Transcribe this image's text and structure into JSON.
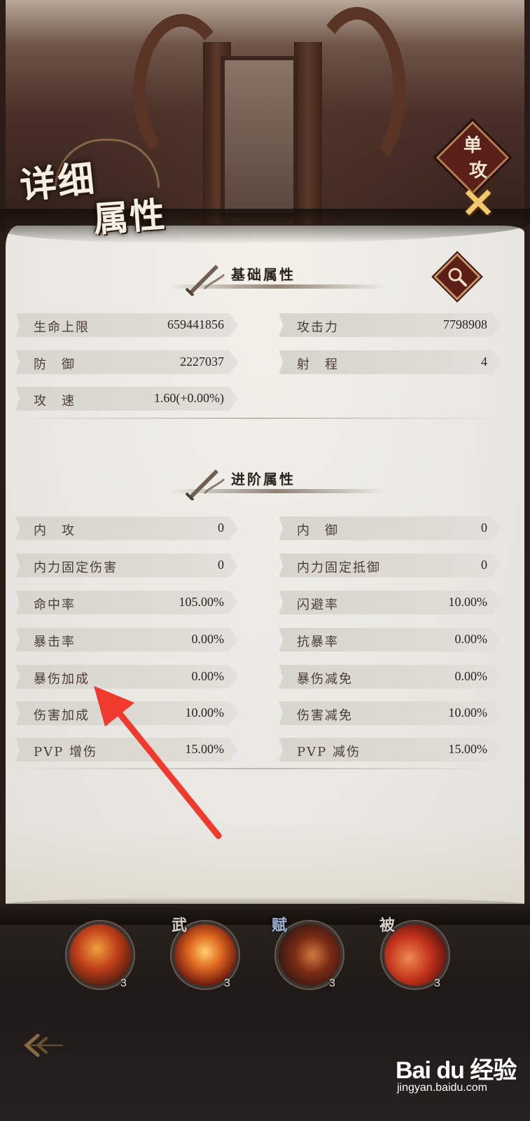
{
  "header": {
    "title_line1": "详细",
    "title_line2": "属性",
    "mode_badge": [
      "单",
      "攻"
    ]
  },
  "basic": {
    "heading": "基础属性",
    "stats": [
      {
        "name": "生命上限",
        "value": "659441856"
      },
      {
        "name": "攻击力",
        "value": "7798908"
      },
      {
        "name": "防　御",
        "value": "2227037"
      },
      {
        "name": "射　程",
        "value": "4"
      },
      {
        "name": "攻　速",
        "value": "1.60(+0.00%)"
      }
    ]
  },
  "advanced": {
    "heading": "进阶属性",
    "stats": [
      {
        "name": "内　攻",
        "value": "0"
      },
      {
        "name": "内　御",
        "value": "0"
      },
      {
        "name": "内力固定伤害",
        "value": "0"
      },
      {
        "name": "内力固定抵御",
        "value": "0"
      },
      {
        "name": "命中率",
        "value": "105.00%"
      },
      {
        "name": "闪避率",
        "value": "10.00%"
      },
      {
        "name": "暴击率",
        "value": "0.00%"
      },
      {
        "name": "抗暴率",
        "value": "0.00%"
      },
      {
        "name": "暴伤加成",
        "value": "0.00%"
      },
      {
        "name": "暴伤减免",
        "value": "0.00%"
      },
      {
        "name": "伤害加成",
        "value": "10.00%"
      },
      {
        "name": "伤害减免",
        "value": "10.00%"
      },
      {
        "name": "PVP 增伤",
        "value": "15.00%"
      },
      {
        "name": "PVP 减伤",
        "value": "15.00%"
      }
    ]
  },
  "skills": [
    {
      "badge": "",
      "level": "3"
    },
    {
      "badge": "武",
      "level": "3"
    },
    {
      "badge": "赋",
      "level": "3"
    },
    {
      "badge": "被",
      "level": "3"
    }
  ],
  "watermark": {
    "main": "Bai du 经验",
    "sub": "jingyan.baidu.com"
  },
  "colors": {
    "accent_red": "#5b1f17",
    "gold": "#f2c96a",
    "annotation_arrow": "#f03a2e"
  }
}
